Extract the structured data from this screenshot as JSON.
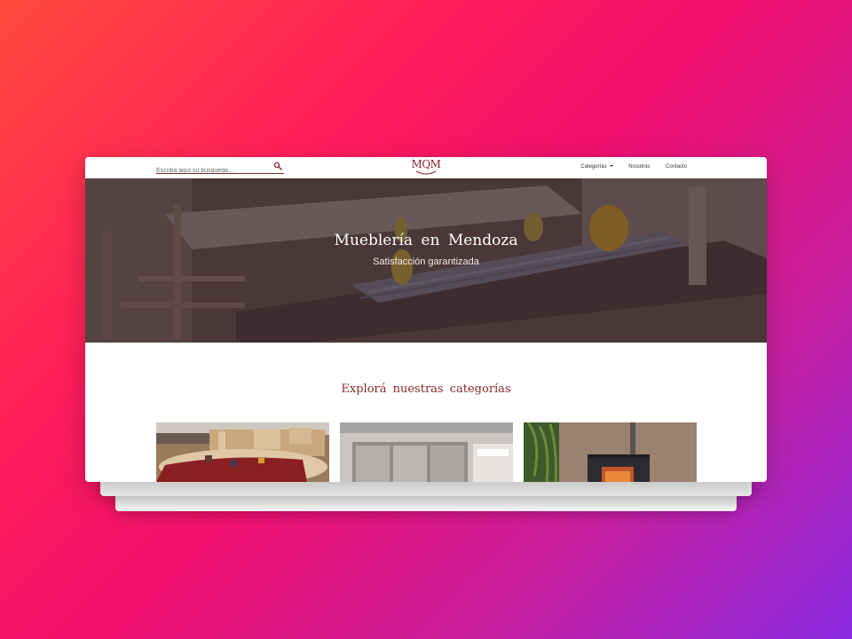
{
  "search": {
    "placeholder": "Escriba aquí su búsqueda..."
  },
  "brand": {
    "logo_text": "MQM"
  },
  "nav": {
    "items": [
      {
        "label": "Categorías"
      },
      {
        "label": "Nosotros"
      },
      {
        "label": "Contacto"
      }
    ]
  },
  "hero": {
    "title": "Mueblería en Mendoza",
    "subtitle": "Satisfacción garantizada"
  },
  "categories": {
    "title": "Explorá nuestras categorías"
  },
  "colors": {
    "brand": "#8b1f2a",
    "accent": "#8b2a2a"
  },
  "icons": {
    "search": "search-icon",
    "dropdown": "caret-down-icon"
  }
}
